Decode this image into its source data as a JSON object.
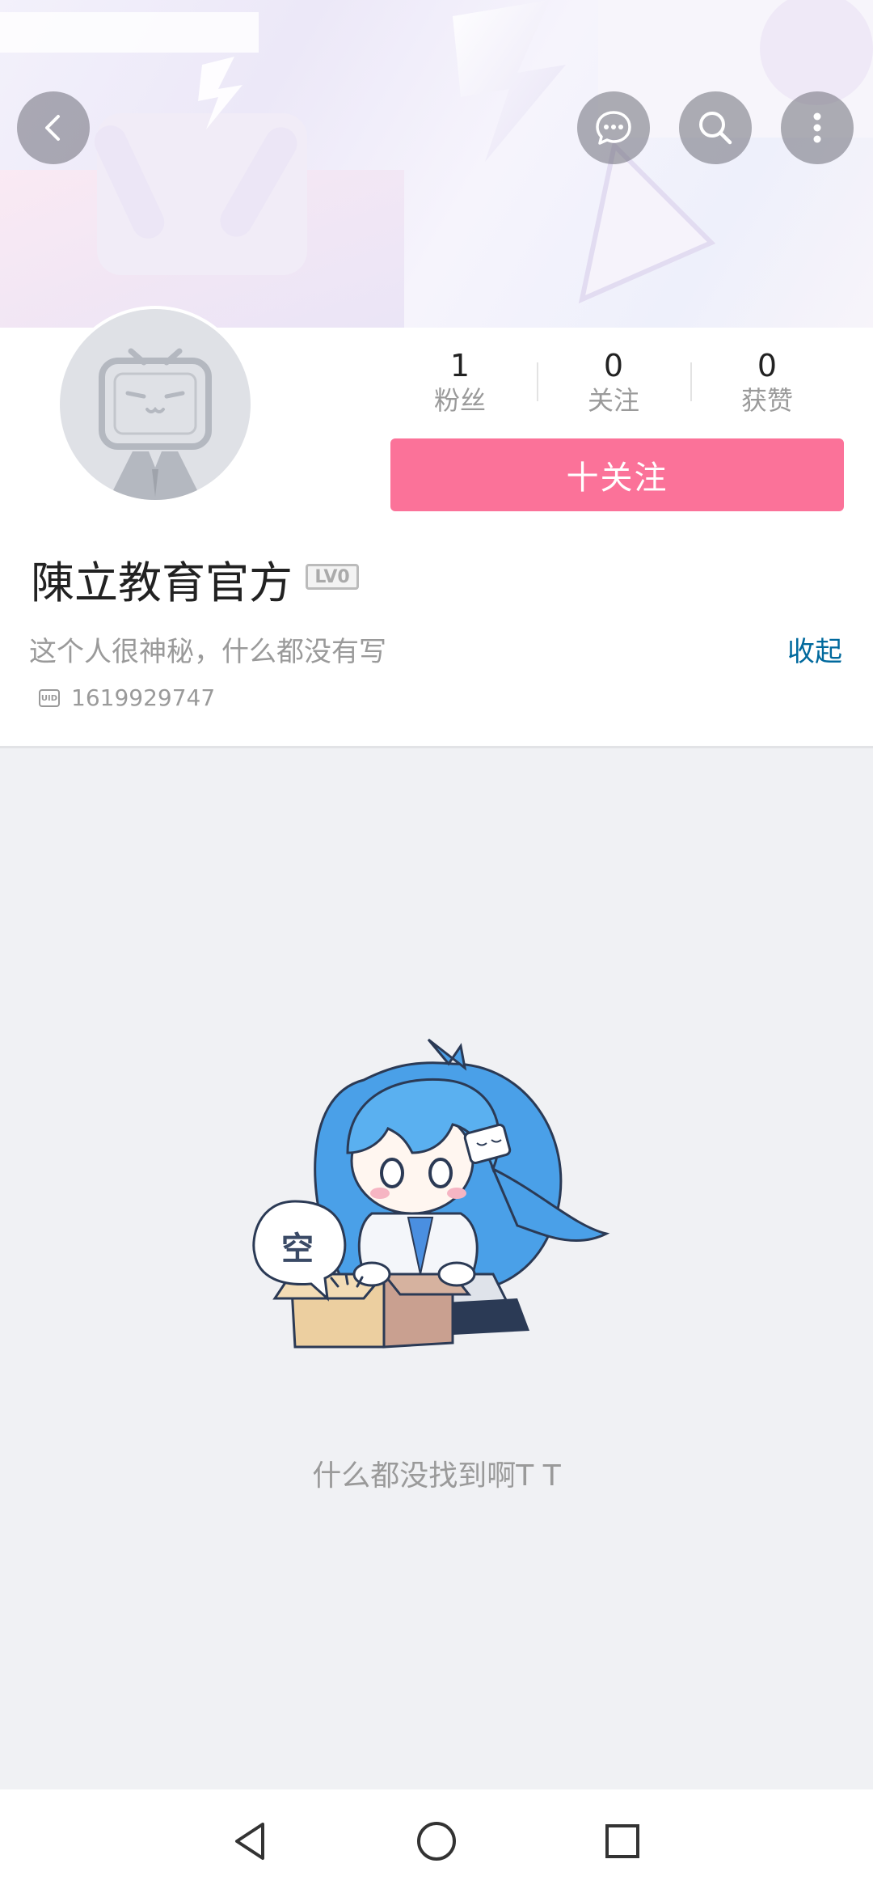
{
  "header": {
    "back_icon": "back-arrow-icon",
    "message_icon": "chat-bubble-icon",
    "search_icon": "search-icon",
    "more_icon": "more-vertical-icon"
  },
  "stats": [
    {
      "value": "1",
      "label": "粉丝"
    },
    {
      "value": "0",
      "label": "关注"
    },
    {
      "value": "0",
      "label": "获赞"
    }
  ],
  "follow_button": "十关注",
  "profile": {
    "name": "陳立教育官方",
    "level": "LV0",
    "bio": "这个人很神秘，什么都没有写",
    "collapse": "收起",
    "uid": "1619929747"
  },
  "empty_state": {
    "bubble_text": "空",
    "message": "什么都没找到啊T T"
  },
  "colors": {
    "accent": "#fb7299",
    "link": "#00699d"
  }
}
